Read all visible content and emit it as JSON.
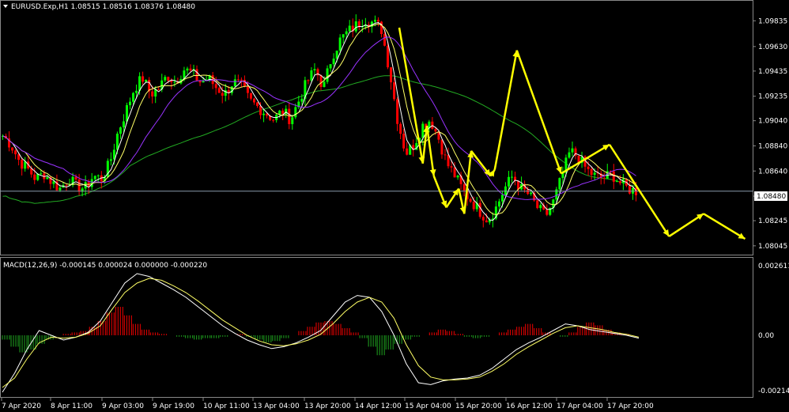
{
  "header": {
    "menu_icon": "triangle-down-icon",
    "symbol_info": "EURUSD.Exp,H1  1.08515 1.08516 1.08376 1.08480"
  },
  "indicator": {
    "label": "MACD(12,26,9) -0.000145 0.000024 0.000000 -0.000220"
  },
  "colors": {
    "background": "#000000",
    "bull_candle": "#00ff00",
    "bear_candle": "#ff0000",
    "ma_fast": "#ffffff",
    "ma_slow1": "#ffff66",
    "ma_slow2": "#9933ff",
    "ma_long": "#22aa22",
    "forecast": "#ffff00",
    "macd_pos": "#cc0000",
    "macd_neg": "#1a8a1a",
    "price_line": "#8899aa"
  },
  "chart_data": {
    "type": "line",
    "price_axis": {
      "ticks": [
        "1.09835",
        "1.09630",
        "1.09435",
        "1.09235",
        "1.09040",
        "1.08840",
        "1.08640",
        "1.08440",
        "1.08245",
        "1.08045"
      ],
      "current_price": "1.08480"
    },
    "macd_axis": {
      "ticks": [
        "0.002611",
        "0.00",
        "-0.00214"
      ]
    },
    "time_axis": {
      "labels": [
        "7 Apr 2020",
        "8 Apr 11:00",
        "9 Apr 03:00",
        "9 Apr 19:00",
        "10 Apr 11:00",
        "13 Apr 04:00",
        "13 Apr 20:00",
        "14 Apr 12:00",
        "15 Apr 04:00",
        "15 Apr 20:00",
        "16 Apr 12:00",
        "17 Apr 04:00",
        "17 Apr 20:00"
      ]
    },
    "price_path": [
      1.0892,
      1.0885,
      1.0872,
      1.0866,
      1.0858,
      1.0862,
      1.0855,
      1.085,
      1.0858,
      1.0852,
      1.085,
      1.086,
      1.0858,
      1.087,
      1.0895,
      1.0912,
      1.093,
      1.0938,
      1.0925,
      1.093,
      1.094,
      1.0935,
      1.0945,
      1.0942,
      1.0935,
      1.0938,
      1.093,
      1.0925,
      1.0935,
      1.0932,
      1.092,
      1.0915,
      1.091,
      1.0905,
      1.0912,
      1.0905,
      1.092,
      1.0935,
      1.0945,
      1.093,
      1.0955,
      1.0968,
      1.0975,
      1.098,
      1.0985,
      1.0982,
      1.0978,
      1.0945,
      1.0905,
      1.0878,
      1.0885,
      1.09,
      1.0905,
      1.089,
      1.087,
      1.086,
      1.0848,
      1.084,
      1.0832,
      1.0825,
      1.0835,
      1.085,
      1.086,
      1.085,
      1.0845,
      1.0835,
      1.0828,
      1.084,
      1.086,
      1.088,
      1.0875,
      1.0865,
      1.086,
      1.0858,
      1.0862,
      1.0855,
      1.085,
      1.0848
    ],
    "forecast_path": [
      [
        0,
        1.0978
      ],
      [
        17,
        1.087
      ],
      [
        20,
        1.09
      ],
      [
        25,
        1.086
      ],
      [
        34,
        1.0835
      ],
      [
        43,
        1.085
      ],
      [
        47,
        1.083
      ],
      [
        52,
        1.088
      ],
      [
        66,
        1.086
      ],
      [
        69,
        1.0865
      ],
      [
        85,
        1.096
      ],
      [
        117,
        1.0862
      ],
      [
        152,
        1.0885
      ],
      [
        195,
        1.0812
      ],
      [
        220,
        1.083
      ],
      [
        250,
        1.081
      ]
    ],
    "forecast_origin": "14 Apr 12:00"
  }
}
